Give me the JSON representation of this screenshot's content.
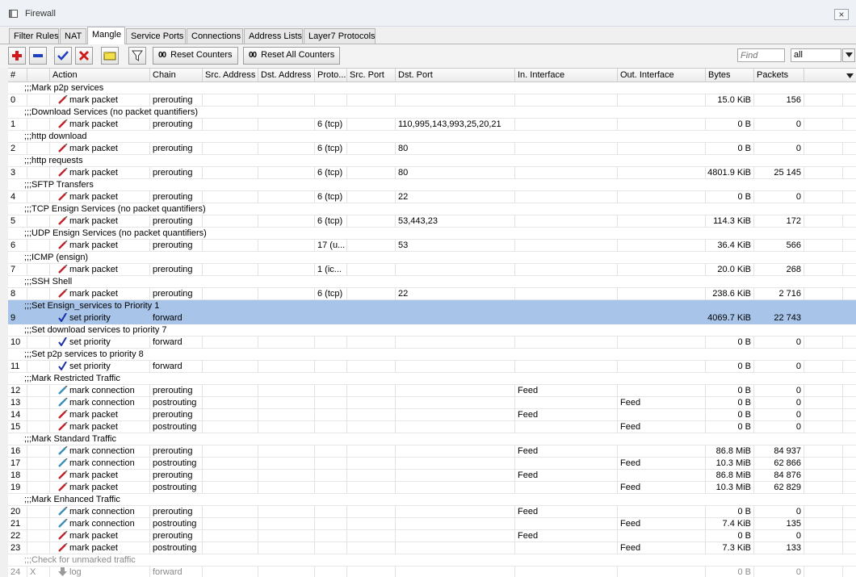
{
  "window": {
    "title": "Firewall",
    "close_glyph": "×"
  },
  "tabs": [
    {
      "label": "Filter Rules"
    },
    {
      "label": "NAT"
    },
    {
      "label": "Mangle"
    },
    {
      "label": "Service Ports"
    },
    {
      "label": "Connections"
    },
    {
      "label": "Address Lists"
    },
    {
      "label": "Layer7 Protocols"
    }
  ],
  "active_tab": "Mangle",
  "toolbar": {
    "reset_counters_label": "Reset Counters",
    "reset_all_counters_label": "Reset All Counters",
    "counter_icon_glyph": "00",
    "find_placeholder": "Find",
    "filter_value": "all"
  },
  "columns": [
    "#",
    "Action",
    "Chain",
    "Src. Address",
    "Dst. Address",
    "Proto...",
    "Src. Port",
    "Dst. Port",
    "In. Interface",
    "Out. Interface",
    "Bytes",
    "Packets"
  ],
  "comment_prefix": ";;;",
  "colors": {
    "selected_row": "#a8c4e8",
    "mark_packet": "#c0202a",
    "mark_connection": "#3a8fb7",
    "set_priority": "#1a2fa8"
  },
  "rows": [
    {
      "type": "comment",
      "text": "Mark p2p services"
    },
    {
      "type": "rule",
      "num": "0",
      "flag": "",
      "action": "mark packet",
      "icon": "mark-packet-icon",
      "chain": "prerouting",
      "src_addr": "",
      "dst_addr": "",
      "proto": "",
      "src_port": "",
      "dst_port": "",
      "in_if": "",
      "out_if": "",
      "bytes": "15.0 KiB",
      "packets": "156"
    },
    {
      "type": "comment",
      "text": "Download Services (no packet quantifiers)"
    },
    {
      "type": "rule",
      "num": "1",
      "flag": "",
      "action": "mark packet",
      "icon": "mark-packet-icon",
      "chain": "prerouting",
      "src_addr": "",
      "dst_addr": "",
      "proto": "6 (tcp)",
      "src_port": "",
      "dst_port": "110,995,143,993,25,20,21",
      "in_if": "",
      "out_if": "",
      "bytes": "0 B",
      "packets": "0"
    },
    {
      "type": "comment",
      "text": "http download"
    },
    {
      "type": "rule",
      "num": "2",
      "flag": "",
      "action": "mark packet",
      "icon": "mark-packet-icon",
      "chain": "prerouting",
      "src_addr": "",
      "dst_addr": "",
      "proto": "6 (tcp)",
      "src_port": "",
      "dst_port": "80",
      "in_if": "",
      "out_if": "",
      "bytes": "0 B",
      "packets": "0"
    },
    {
      "type": "comment",
      "text": "http requests"
    },
    {
      "type": "rule",
      "num": "3",
      "flag": "",
      "action": "mark packet",
      "icon": "mark-packet-icon",
      "chain": "prerouting",
      "src_addr": "",
      "dst_addr": "",
      "proto": "6 (tcp)",
      "src_port": "",
      "dst_port": "80",
      "in_if": "",
      "out_if": "",
      "bytes": "4801.9 KiB",
      "packets": "25 145"
    },
    {
      "type": "comment",
      "text": "SFTP Transfers"
    },
    {
      "type": "rule",
      "num": "4",
      "flag": "",
      "action": "mark packet",
      "icon": "mark-packet-icon",
      "chain": "prerouting",
      "src_addr": "",
      "dst_addr": "",
      "proto": "6 (tcp)",
      "src_port": "",
      "dst_port": "22",
      "in_if": "",
      "out_if": "",
      "bytes": "0 B",
      "packets": "0"
    },
    {
      "type": "comment",
      "text": "TCP Ensign Services (no packet quantifiers)"
    },
    {
      "type": "rule",
      "num": "5",
      "flag": "",
      "action": "mark packet",
      "icon": "mark-packet-icon",
      "chain": "prerouting",
      "src_addr": "",
      "dst_addr": "",
      "proto": "6 (tcp)",
      "src_port": "",
      "dst_port": "53,443,23",
      "in_if": "",
      "out_if": "",
      "bytes": "114.3 KiB",
      "packets": "172"
    },
    {
      "type": "comment",
      "text": "UDP Ensign Services (no packet quantifiers)"
    },
    {
      "type": "rule",
      "num": "6",
      "flag": "",
      "action": "mark packet",
      "icon": "mark-packet-icon",
      "chain": "prerouting",
      "src_addr": "",
      "dst_addr": "",
      "proto": "17 (u...",
      "src_port": "",
      "dst_port": "53",
      "in_if": "",
      "out_if": "",
      "bytes": "36.4 KiB",
      "packets": "566"
    },
    {
      "type": "comment",
      "text": "ICMP (ensign)"
    },
    {
      "type": "rule",
      "num": "7",
      "flag": "",
      "action": "mark packet",
      "icon": "mark-packet-icon",
      "chain": "prerouting",
      "src_addr": "",
      "dst_addr": "",
      "proto": "1 (ic...",
      "src_port": "",
      "dst_port": "",
      "in_if": "",
      "out_if": "",
      "bytes": "20.0 KiB",
      "packets": "268"
    },
    {
      "type": "comment",
      "text": "SSH Shell"
    },
    {
      "type": "rule",
      "num": "8",
      "flag": "",
      "action": "mark packet",
      "icon": "mark-packet-icon",
      "chain": "prerouting",
      "src_addr": "",
      "dst_addr": "",
      "proto": "6 (tcp)",
      "src_port": "",
      "dst_port": "22",
      "in_if": "",
      "out_if": "",
      "bytes": "238.6 KiB",
      "packets": "2 716"
    },
    {
      "type": "comment",
      "text": "Set Ensign_services to Priority 1",
      "selected": true
    },
    {
      "type": "rule",
      "num": "9",
      "flag": "",
      "action": "set priority",
      "icon": "set-priority-icon",
      "chain": "forward",
      "src_addr": "",
      "dst_addr": "",
      "proto": "",
      "src_port": "",
      "dst_port": "",
      "in_if": "",
      "out_if": "",
      "bytes": "4069.7 KiB",
      "packets": "22 743",
      "selected": true
    },
    {
      "type": "comment",
      "text": "Set download services to priority 7"
    },
    {
      "type": "rule",
      "num": "10",
      "flag": "",
      "action": "set priority",
      "icon": "set-priority-icon",
      "chain": "forward",
      "src_addr": "",
      "dst_addr": "",
      "proto": "",
      "src_port": "",
      "dst_port": "",
      "in_if": "",
      "out_if": "",
      "bytes": "0 B",
      "packets": "0"
    },
    {
      "type": "comment",
      "text": "Set p2p services to priority 8"
    },
    {
      "type": "rule",
      "num": "11",
      "flag": "",
      "action": "set priority",
      "icon": "set-priority-icon",
      "chain": "forward",
      "src_addr": "",
      "dst_addr": "",
      "proto": "",
      "src_port": "",
      "dst_port": "",
      "in_if": "",
      "out_if": "",
      "bytes": "0 B",
      "packets": "0"
    },
    {
      "type": "comment",
      "text": "Mark Restricted Traffic"
    },
    {
      "type": "rule",
      "num": "12",
      "flag": "",
      "action": "mark connection",
      "icon": "mark-connection-icon",
      "chain": "prerouting",
      "src_addr": "",
      "dst_addr": "",
      "proto": "",
      "src_port": "",
      "dst_port": "",
      "in_if": "Feed",
      "out_if": "",
      "bytes": "0 B",
      "packets": "0"
    },
    {
      "type": "rule",
      "num": "13",
      "flag": "",
      "action": "mark connection",
      "icon": "mark-connection-icon",
      "chain": "postrouting",
      "src_addr": "",
      "dst_addr": "",
      "proto": "",
      "src_port": "",
      "dst_port": "",
      "in_if": "",
      "out_if": "Feed",
      "bytes": "0 B",
      "packets": "0"
    },
    {
      "type": "rule",
      "num": "14",
      "flag": "",
      "action": "mark packet",
      "icon": "mark-packet-icon",
      "chain": "prerouting",
      "src_addr": "",
      "dst_addr": "",
      "proto": "",
      "src_port": "",
      "dst_port": "",
      "in_if": "Feed",
      "out_if": "",
      "bytes": "0 B",
      "packets": "0"
    },
    {
      "type": "rule",
      "num": "15",
      "flag": "",
      "action": "mark packet",
      "icon": "mark-packet-icon",
      "chain": "postrouting",
      "src_addr": "",
      "dst_addr": "",
      "proto": "",
      "src_port": "",
      "dst_port": "",
      "in_if": "",
      "out_if": "Feed",
      "bytes": "0 B",
      "packets": "0"
    },
    {
      "type": "comment",
      "text": "Mark Standard Traffic"
    },
    {
      "type": "rule",
      "num": "16",
      "flag": "",
      "action": "mark connection",
      "icon": "mark-connection-icon",
      "chain": "prerouting",
      "src_addr": "",
      "dst_addr": "",
      "proto": "",
      "src_port": "",
      "dst_port": "",
      "in_if": "Feed",
      "out_if": "",
      "bytes": "86.8 MiB",
      "packets": "84 937"
    },
    {
      "type": "rule",
      "num": "17",
      "flag": "",
      "action": "mark connection",
      "icon": "mark-connection-icon",
      "chain": "postrouting",
      "src_addr": "",
      "dst_addr": "",
      "proto": "",
      "src_port": "",
      "dst_port": "",
      "in_if": "",
      "out_if": "Feed",
      "bytes": "10.3 MiB",
      "packets": "62 866"
    },
    {
      "type": "rule",
      "num": "18",
      "flag": "",
      "action": "mark packet",
      "icon": "mark-packet-icon",
      "chain": "prerouting",
      "src_addr": "",
      "dst_addr": "",
      "proto": "",
      "src_port": "",
      "dst_port": "",
      "in_if": "Feed",
      "out_if": "",
      "bytes": "86.8 MiB",
      "packets": "84 876"
    },
    {
      "type": "rule",
      "num": "19",
      "flag": "",
      "action": "mark packet",
      "icon": "mark-packet-icon",
      "chain": "postrouting",
      "src_addr": "",
      "dst_addr": "",
      "proto": "",
      "src_port": "",
      "dst_port": "",
      "in_if": "",
      "out_if": "Feed",
      "bytes": "10.3 MiB",
      "packets": "62 829"
    },
    {
      "type": "comment",
      "text": "Mark Enhanced Traffic"
    },
    {
      "type": "rule",
      "num": "20",
      "flag": "",
      "action": "mark connection",
      "icon": "mark-connection-icon",
      "chain": "prerouting",
      "src_addr": "",
      "dst_addr": "",
      "proto": "",
      "src_port": "",
      "dst_port": "",
      "in_if": "Feed",
      "out_if": "",
      "bytes": "0 B",
      "packets": "0"
    },
    {
      "type": "rule",
      "num": "21",
      "flag": "",
      "action": "mark connection",
      "icon": "mark-connection-icon",
      "chain": "postrouting",
      "src_addr": "",
      "dst_addr": "",
      "proto": "",
      "src_port": "",
      "dst_port": "",
      "in_if": "",
      "out_if": "Feed",
      "bytes": "7.4 KiB",
      "packets": "135"
    },
    {
      "type": "rule",
      "num": "22",
      "flag": "",
      "action": "mark packet",
      "icon": "mark-packet-icon",
      "chain": "prerouting",
      "src_addr": "",
      "dst_addr": "",
      "proto": "",
      "src_port": "",
      "dst_port": "",
      "in_if": "Feed",
      "out_if": "",
      "bytes": "0 B",
      "packets": "0"
    },
    {
      "type": "rule",
      "num": "23",
      "flag": "",
      "action": "mark packet",
      "icon": "mark-packet-icon",
      "chain": "postrouting",
      "src_addr": "",
      "dst_addr": "",
      "proto": "",
      "src_port": "",
      "dst_port": "",
      "in_if": "",
      "out_if": "Feed",
      "bytes": "7.3 KiB",
      "packets": "133"
    },
    {
      "type": "comment",
      "text": "Check for unmarked traffic",
      "disabled": true
    },
    {
      "type": "rule",
      "num": "24",
      "flag": "X",
      "action": "log",
      "icon": "log-icon",
      "chain": "forward",
      "src_addr": "",
      "dst_addr": "",
      "proto": "",
      "src_port": "",
      "dst_port": "",
      "in_if": "",
      "out_if": "",
      "bytes": "0 B",
      "packets": "0",
      "disabled": true
    }
  ]
}
